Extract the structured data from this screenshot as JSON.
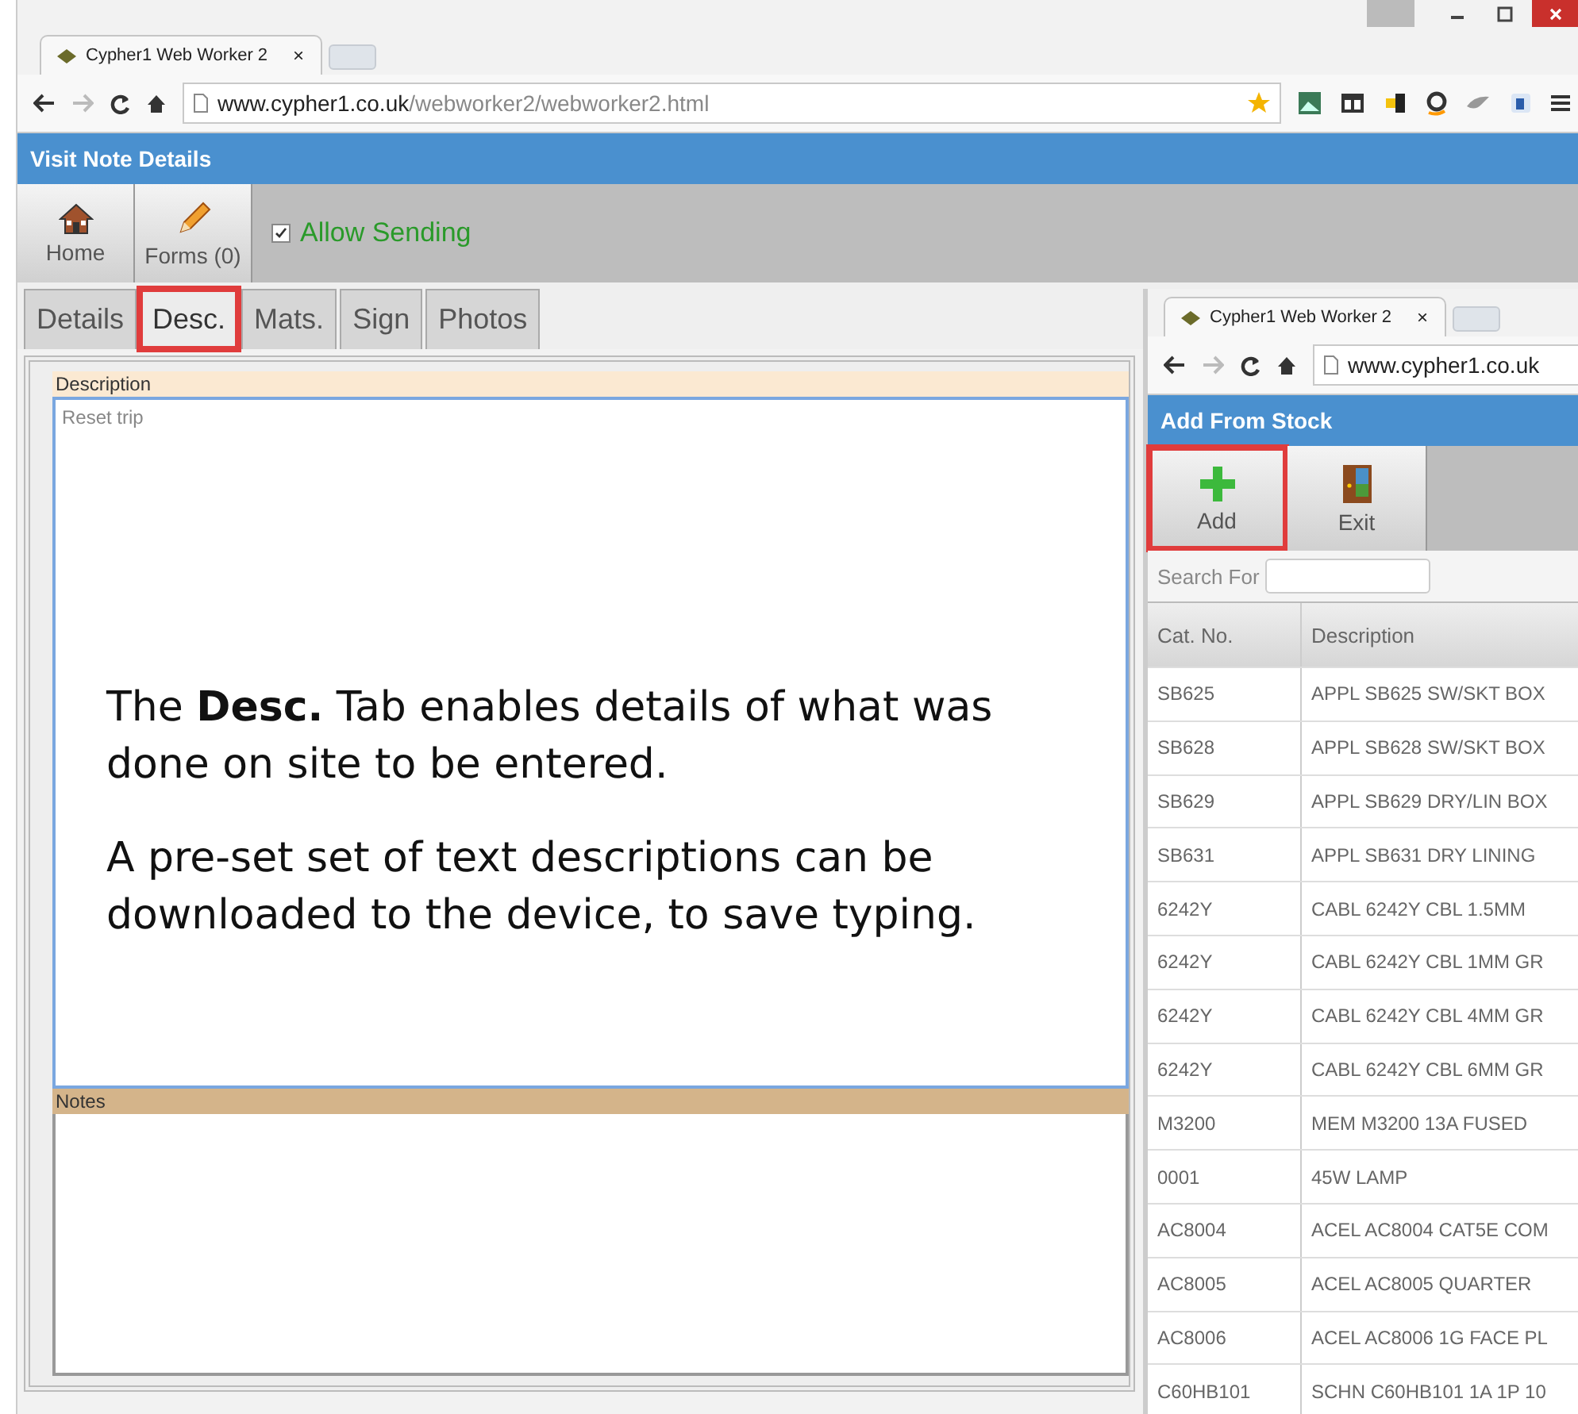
{
  "browser": {
    "tab_title": "Cypher1 Web Worker 2",
    "tab_close": "×",
    "url_host": "www.cypher1.co.uk",
    "url_path": "/webworker2/webworker2.html"
  },
  "app": {
    "title": "Visit Note Details",
    "toolbar": [
      {
        "label": "Home",
        "kind": "home"
      },
      {
        "label": "Forms (0)",
        "kind": "pencil"
      }
    ],
    "allow_sending": {
      "label": "Allow Sending",
      "checked": true
    },
    "tabs": [
      {
        "label": "Details",
        "selected": false,
        "highlighted": false
      },
      {
        "label": "Desc.",
        "selected": true,
        "highlighted": true
      },
      {
        "label": "Mats.",
        "selected": false,
        "highlighted": false
      },
      {
        "label": "Sign",
        "selected": false,
        "highlighted": false
      },
      {
        "label": "Photos",
        "selected": false,
        "highlighted": false
      }
    ],
    "description": {
      "label": "Description",
      "value": "Reset trip"
    },
    "notes": {
      "label": "Notes"
    }
  },
  "annotation": [
    "The **Desc.** Tab enables details of what was done on site to be entered.",
    "A pre-set set of text descriptions can be downloaded to the device, to save typing."
  ],
  "stock_window": {
    "tab_title": "Cypher1 Web Worker 2",
    "tab_close": "×",
    "url_host": "www.cypher1.co.uk",
    "title": "Add From Stock",
    "toolbar": [
      {
        "label": "Add",
        "kind": "plus",
        "highlighted": true
      },
      {
        "label": "Exit",
        "kind": "door",
        "highlighted": false
      }
    ],
    "search_label": "Search For",
    "columns": [
      "Cat. No.",
      "Description"
    ],
    "rows": [
      [
        "SB625",
        "APPL SB625 SW/SKT BOX"
      ],
      [
        "SB628",
        "APPL SB628 SW/SKT BOX"
      ],
      [
        "SB629",
        "APPL SB629 DRY/LIN BOX"
      ],
      [
        "SB631",
        "APPL SB631 DRY LINING"
      ],
      [
        "6242Y",
        "CABL 6242Y CBL 1.5MM"
      ],
      [
        "6242Y",
        "CABL 6242Y CBL 1MM GR"
      ],
      [
        "6242Y",
        "CABL 6242Y CBL 4MM GR"
      ],
      [
        "6242Y",
        "CABL 6242Y CBL 6MM GR"
      ],
      [
        "M3200",
        "MEM  M3200 13A FUSED"
      ],
      [
        "0001",
        "45W LAMP"
      ],
      [
        "AC8004",
        "ACEL AC8004 CAT5E COM"
      ],
      [
        "AC8005",
        "ACEL AC8005 QUARTER"
      ],
      [
        "AC8006",
        "ACEL AC8006 1G FACE PL"
      ],
      [
        "C60HB101",
        "SCHN C60HB101 1A 1P 10"
      ]
    ]
  }
}
